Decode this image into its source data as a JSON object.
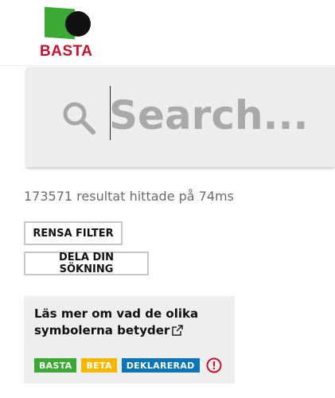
{
  "header": {
    "logo_text": "BASTA",
    "colors": {
      "logo_green": "#3aaa35",
      "logo_dot": "#111111",
      "logo_red": "#c8102e"
    }
  },
  "search": {
    "placeholder": "Search...",
    "value": ""
  },
  "results": {
    "text": "173571 resultat hittade på 74ms"
  },
  "actions": {
    "clear_filter_label": "RENSA FILTER",
    "share_search_label": "DELA DIN SÖKNING"
  },
  "info": {
    "link_text": "Läs mer om vad de olika symbolerna betyder",
    "badges": [
      {
        "label": "BASTA",
        "color": "#3aaa35"
      },
      {
        "label": "BETA",
        "color": "#f5b800"
      },
      {
        "label": "DEKLARERAD",
        "color": "#0a76b8"
      }
    ],
    "alert_icon": "alert-circle-icon",
    "alert_color": "#c8102e"
  }
}
